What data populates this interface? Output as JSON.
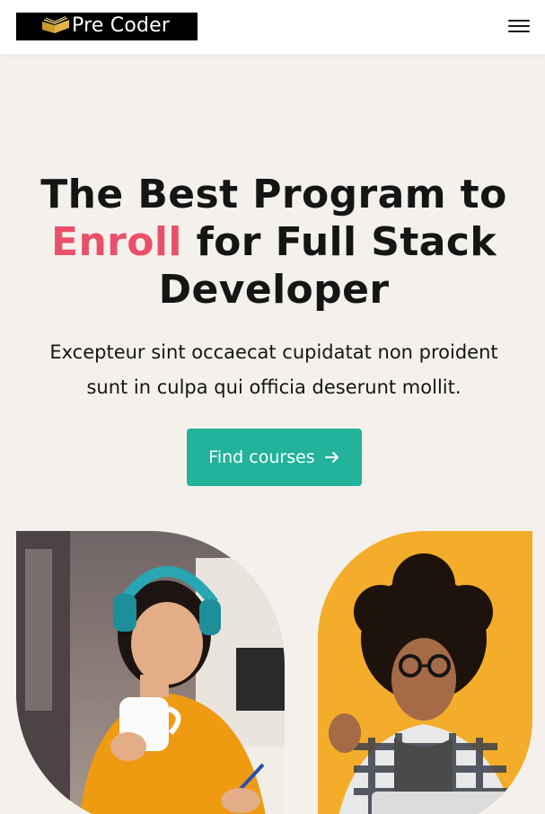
{
  "header": {
    "logo_text": "Pre Coder",
    "menu_icon": "hamburger-menu-icon"
  },
  "hero": {
    "title_line1": "The Best Program to",
    "title_accent": "Enroll",
    "title_line2_rest": " for Full Stack",
    "title_line3": "Developer",
    "subtitle": "Excepteur sint occaecat cupidatat non proident sunt in culpa qui officia deserunt mollit.",
    "cta_label": "Find courses",
    "cta_icon": "arrow-right-icon"
  },
  "images": {
    "left_alt": "",
    "right_alt": ""
  },
  "colors": {
    "accent": "#e9506a",
    "primary": "#22b39a",
    "background": "#f4f1ec",
    "right_photo_bg": "#f3ad2b"
  }
}
